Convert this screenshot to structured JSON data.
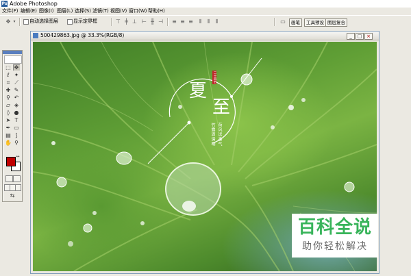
{
  "app": {
    "title": "Adobe Photoshop",
    "logo_icon": "photoshop-logo-icon"
  },
  "menu": {
    "items": [
      {
        "label": "文件(F)"
      },
      {
        "label": "编辑(E)"
      },
      {
        "label": "图像(I)"
      },
      {
        "label": "图层(L)"
      },
      {
        "label": "选择(S)"
      },
      {
        "label": "滤镜(T)"
      },
      {
        "label": "视图(V)"
      },
      {
        "label": "窗口(W)"
      },
      {
        "label": "帮助(H)"
      }
    ]
  },
  "options": {
    "auto_select_layer": "自动选择图层",
    "show_bounding_box": "显示定界框",
    "tabs": [
      "画笔",
      "工具预设",
      "图层复合"
    ]
  },
  "document": {
    "title": "500429863.jpg @ 33.3%(RGB/8)",
    "minimize": "_",
    "maximize": "□",
    "close": "×"
  },
  "artwork": {
    "big_char_1": "夏",
    "big_char_2": "至",
    "seal_text": "二十四节",
    "poem_line_1": "细",
    "poem_line_2": "菰",
    "poem_cols": [
      "荷风送香气",
      "竹露滴清响"
    ]
  },
  "colors": {
    "foreground": "#c00000",
    "background": "#ffffff",
    "accent": "#38b45a"
  },
  "watermark": {
    "main": "百科全说",
    "sub": "助你轻松解决"
  }
}
